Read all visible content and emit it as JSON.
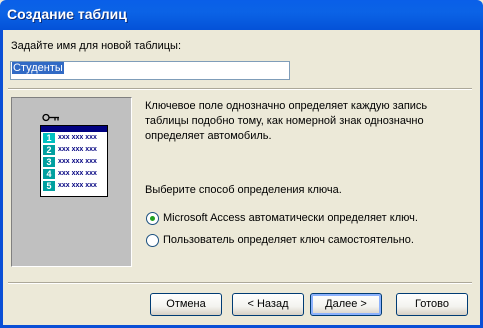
{
  "window": {
    "title": "Создание таблиц"
  },
  "form": {
    "prompt": "Задайте имя для новой таблицы:",
    "table_name": "Студенты"
  },
  "illustration": {
    "rows": [
      "1",
      "2",
      "3",
      "4",
      "5"
    ],
    "cell_text": "xxx xxx xxx"
  },
  "description": "Ключевое поле однозначно определяет каждую запись таблицы подобно тому, как номерной знак однозначно определяет автомобиль.",
  "key_choice": {
    "label": "Выберите способ определения ключа.",
    "options": [
      {
        "label": "Microsoft Access автоматически определяет ключ.",
        "selected": true
      },
      {
        "label": "Пользователь определяет ключ самостоятельно.",
        "selected": false
      }
    ]
  },
  "buttons": {
    "cancel": "Отмена",
    "back": "< Назад",
    "next": "Далее >",
    "finish": "Готово"
  }
}
